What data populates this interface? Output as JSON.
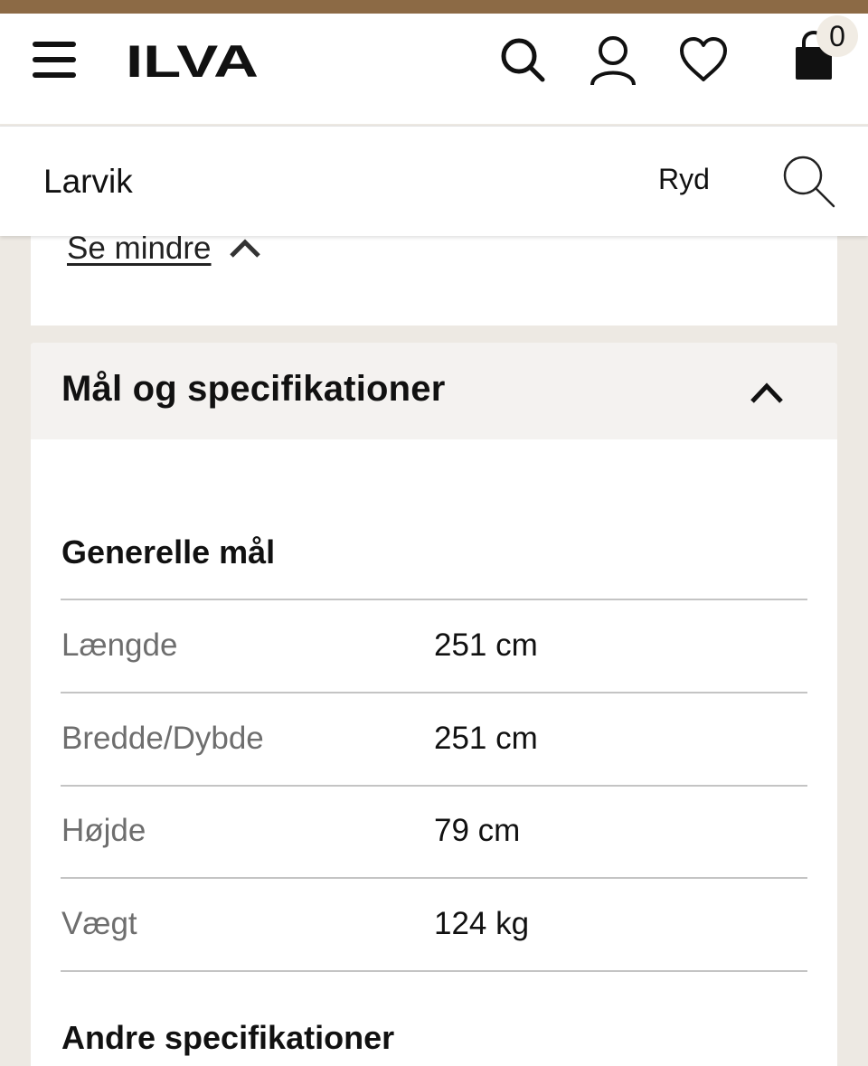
{
  "header": {
    "logo_text": "ILVA",
    "cart_count": "0"
  },
  "search": {
    "value": "Larvik",
    "clear_label": "Ryd"
  },
  "description_card": {
    "see_less_label": "Se mindre"
  },
  "specs_card": {
    "title": "Mål og specifikationer",
    "general_title": "Generelle mål",
    "rows": [
      {
        "label": "Længde",
        "value": "251 cm"
      },
      {
        "label": "Bredde/Dybde",
        "value": "251 cm"
      },
      {
        "label": "Højde",
        "value": "79 cm"
      },
      {
        "label": "Vægt",
        "value": "124 kg"
      }
    ],
    "other_title": "Andre specifikationer"
  },
  "colors": {
    "topbar": "#8c6a45",
    "page_bg": "#ede9e3",
    "card_header_bg": "#f4f2f0"
  }
}
